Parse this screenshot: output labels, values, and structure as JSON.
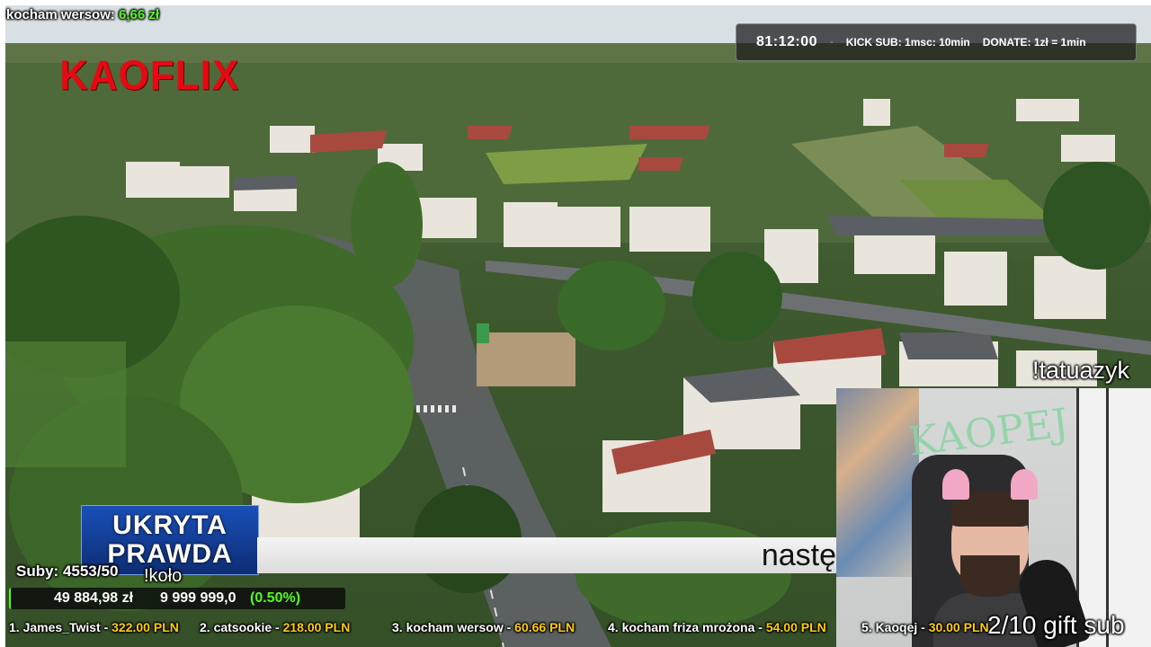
{
  "top_label": {
    "text": "kocham wersow:",
    "amount": "6,66 zł"
  },
  "logo": "KAOFLIX",
  "timer": {
    "time": "81:12:00",
    "separator": "-",
    "kick_sub": "KICK SUB: 1msc: 10min",
    "donate": "DONATE: 1zł = 1min"
  },
  "tattoo_command": "!tatuazyk",
  "webcam": {
    "wall_text": "KAOPEJ"
  },
  "gift_sub": "2/10 gift sub",
  "news": {
    "logo_line1": "UKRYTA",
    "logo_line2": "PRAWDA",
    "ticker_text": "nastę"
  },
  "subs": {
    "label": "Suby: 4553/50"
  },
  "kolo": "!koło",
  "goal": {
    "current": "49 884,98 zł",
    "max": "9 999 999,0",
    "percent": "(0.50%)",
    "progress": 0.005
  },
  "top_donors": [
    {
      "label": "1. James_Twist - ",
      "amount": "322.00 PLN"
    },
    {
      "label": "2. catsookie - ",
      "amount": "218.00 PLN"
    },
    {
      "label": "3. kocham wersow - ",
      "amount": "60.66 PLN"
    },
    {
      "label": "4. kocham friza mrożona - ",
      "amount": "54.00 PLN"
    },
    {
      "label": "5. Kaoqej - ",
      "amount": "30.00 PLN"
    }
  ],
  "colors": {
    "accent_green": "#53fc18",
    "donation_yellow": "#ffcc00",
    "logo_red": "#e50914"
  }
}
